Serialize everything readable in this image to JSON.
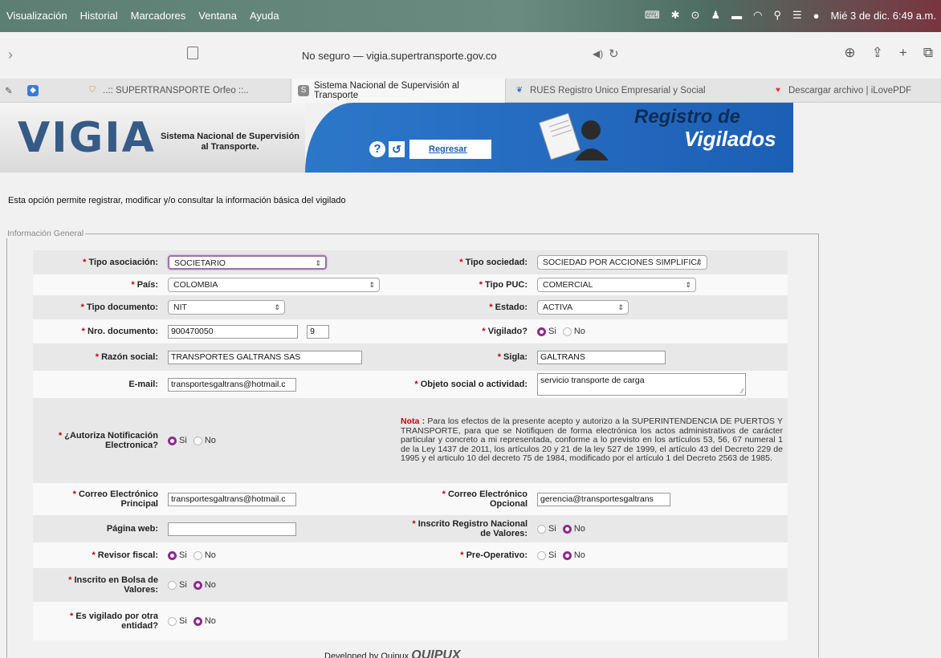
{
  "menubar": {
    "items": [
      "Visualización",
      "Historial",
      "Marcadores",
      "Ventana",
      "Ayuda"
    ],
    "clock": "Mié 3 de dic.  6:49 a.m."
  },
  "toolbar": {
    "address": "No seguro — vigia.supertransporte.gov.co"
  },
  "tabs": [
    {
      "label": "..:: SUPERTRANSPORTE Orfeo ::..",
      "favicon": "shield-icon"
    },
    {
      "label": "Sistema Nacional de Supervisión al Transporte",
      "favicon": "S"
    },
    {
      "label": "RUES Registro Unico Empresarial y Social",
      "favicon": "rues-icon"
    },
    {
      "label": "Descargar archivo | iLovePDF",
      "favicon": "heart-icon"
    }
  ],
  "banner": {
    "logo": "VIGIA",
    "subtitle_line1": "Sistema Nacional de Supervisión",
    "subtitle_line2": "al Transporte.",
    "regresar": "Regresar",
    "title_line1": "Registro de",
    "title_line2": "Vigilados"
  },
  "intro": "Esta opción permite registrar, modificar y/o consultar la información básica del vigilado",
  "fieldset_legend": "Información General",
  "form": {
    "tipo_asociacion": {
      "label": "Tipo asociación:",
      "value": "SOCIETARIO"
    },
    "tipo_sociedad": {
      "label": "Tipo sociedad:",
      "value": "SOCIEDAD POR ACCIONES SIMPLIFIC/"
    },
    "pais": {
      "label": "País:",
      "value": "COLOMBIA"
    },
    "tipo_puc": {
      "label": "Tipo PUC:",
      "value": "COMERCIAL"
    },
    "tipo_documento": {
      "label": "Tipo documento:",
      "value": "NIT"
    },
    "estado": {
      "label": "Estado:",
      "value": "ACTIVA"
    },
    "nro_documento": {
      "label": "Nro. documento:",
      "value": "900470050",
      "dv": "9"
    },
    "vigilado": {
      "label": "Vigilado?",
      "si": "Si",
      "no": "No"
    },
    "razon_social": {
      "label": "Razón social:",
      "value": "TRANSPORTES GALTRANS  SAS"
    },
    "sigla": {
      "label": "Sigla:",
      "value": "GALTRANS"
    },
    "email": {
      "label": "E-mail:",
      "value": "transportesgaltrans@hotmail.c"
    },
    "objeto_social": {
      "label": "Objeto social o actividad:",
      "value": "servicio transporte de carga"
    },
    "autoriza": {
      "label_line1": "¿Autoriza Notificación",
      "label_line2": "Electronica?",
      "si": "Si",
      "no": "No"
    },
    "nota_title": "Nota :",
    "nota": "Para los efectos de la presente acepto y autorizo a la SUPERINTENDENCIA DE PUERTOS Y TRANSPORTE, para que se Notifiquen de forma electrónica los actos administrativos de carácter particular y concreto a mi representada, conforme a lo previsto en los artículos 53, 56, 67 numeral 1 de la Ley 1437 de 2011, los artículos 20 y 21 de la ley 527 de 1999, el artículo 43 del Decreto 229 de 1995 y el articulo 10 del decreto 75 de 1984, modificado por el artículo 1 del Decreto 2563 de 1985.",
    "correo_principal": {
      "label_line1": "Correo Electrónico",
      "label_line2": "Principal",
      "value": "transportesgaltrans@hotmail.c"
    },
    "correo_opcional": {
      "label_line1": "Correo Electrónico",
      "label_line2": "Opcional",
      "value": "gerencia@transportesgaltrans"
    },
    "pagina_web": {
      "label": "Página web:",
      "value": ""
    },
    "inscrito_rnv": {
      "label_line1": "Inscrito Registro Nacional",
      "label_line2": "de Valores:",
      "si": "Si",
      "no": "No"
    },
    "revisor_fiscal": {
      "label": "Revisor fiscal:",
      "si": "Si",
      "no": "No"
    },
    "pre_operativo": {
      "label": "Pre-Operativo:",
      "si": "Si",
      "no": "No"
    },
    "inscrito_bolsa": {
      "label_line1": "Inscrito en Bolsa de",
      "label_line2": "Valores:",
      "si": "Si",
      "no": "No"
    },
    "vigilado_otra": {
      "label_line1": "Es vigilado por otra",
      "label_line2": "entidad?",
      "si": "Si",
      "no": "No"
    }
  },
  "footer": {
    "text": "Developed by Quipux",
    "logo": "QUIPUX"
  }
}
